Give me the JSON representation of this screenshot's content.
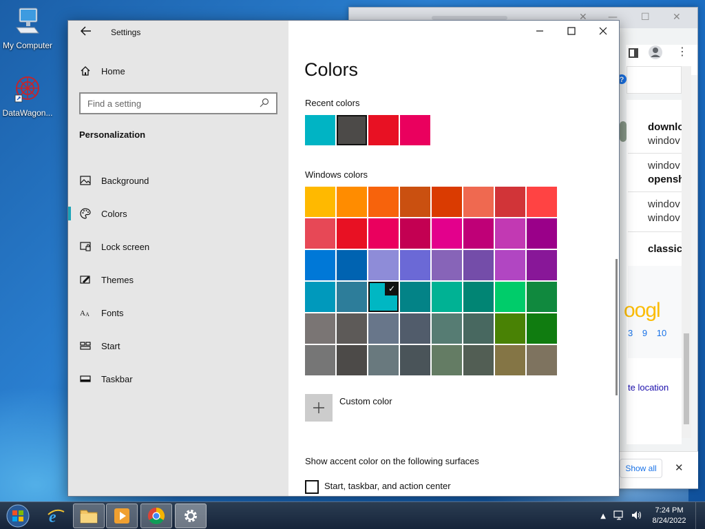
{
  "desktop": {
    "icons": [
      {
        "label": "My Computer"
      },
      {
        "label": "DataWagon..."
      }
    ]
  },
  "background_browser": {
    "results": [
      "downlo",
      "windov",
      "windov",
      "opensh",
      "windov",
      "windov",
      "classic"
    ],
    "logo_text": "oogl",
    "pages": [
      "3",
      "9",
      "10"
    ],
    "location_link": "te location",
    "show_all": "Show all"
  },
  "settings": {
    "title": "Settings",
    "home": "Home",
    "search_placeholder": "Find a setting",
    "section": "Personalization",
    "nav": [
      {
        "label": "Background",
        "icon": "picture-icon"
      },
      {
        "label": "Colors",
        "icon": "palette-icon"
      },
      {
        "label": "Lock screen",
        "icon": "lock-screen-icon"
      },
      {
        "label": "Themes",
        "icon": "themes-icon"
      },
      {
        "label": "Fonts",
        "icon": "fonts-icon"
      },
      {
        "label": "Start",
        "icon": "start-icon"
      },
      {
        "label": "Taskbar",
        "icon": "taskbar-icon"
      }
    ],
    "active_nav": "Colors",
    "page_title": "Colors",
    "recent_label": "Recent colors",
    "recent_colors": [
      "#00b4c4",
      "#4c4a48",
      "#e81123",
      "#ea005e"
    ],
    "windows_label": "Windows colors",
    "windows_colors": [
      "#ffb900",
      "#ff8c00",
      "#f7630c",
      "#ca5010",
      "#da3b01",
      "#ef6950",
      "#d13438",
      "#ff4343",
      "#e74856",
      "#e81123",
      "#ea005e",
      "#c30052",
      "#e3008c",
      "#bf0077",
      "#c239b3",
      "#9a0089",
      "#0078d7",
      "#0063b1",
      "#8e8cd8",
      "#6b69d6",
      "#8764b8",
      "#744da9",
      "#b146c2",
      "#881798",
      "#0099bc",
      "#2d7d9a",
      "#00b7c3",
      "#038387",
      "#00b294",
      "#018574",
      "#00cc6a",
      "#10893e",
      "#7a7574",
      "#5d5a58",
      "#68768a",
      "#515c6b",
      "#567c73",
      "#486860",
      "#498205",
      "#107c10",
      "#767676",
      "#4c4a48",
      "#69797e",
      "#4a5459",
      "#647c64",
      "#525e54",
      "#847545",
      "#7e735f"
    ],
    "selected_index": 26,
    "custom_color": "Custom color",
    "accent_surfaces_label": "Show accent color on the following surfaces",
    "checkbox_label": "Start, taskbar, and action center"
  },
  "taskbar": {
    "time": "7:24 PM",
    "date": "8/24/2022"
  }
}
